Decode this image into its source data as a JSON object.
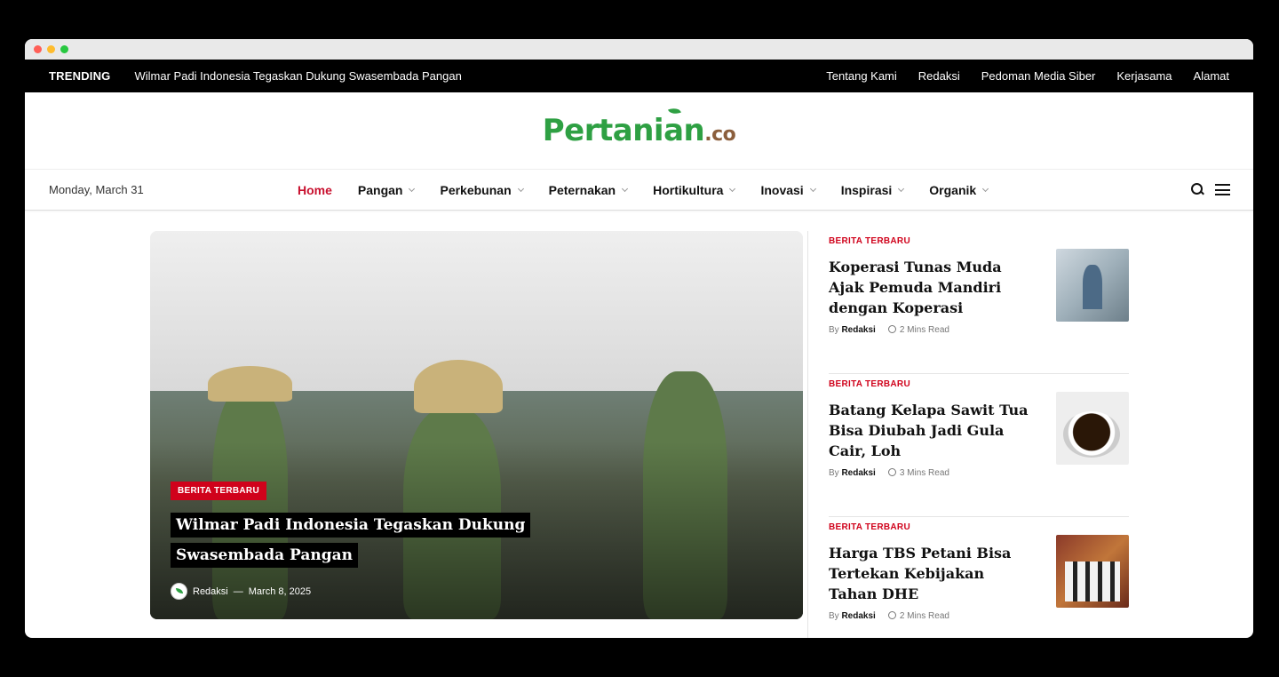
{
  "topbar": {
    "trending_label": "TRENDING",
    "trending_headline": "Wilmar Padi Indonesia Tegaskan Dukung Swasembada Pangan",
    "links": [
      "Tentang Kami",
      "Redaksi",
      "Pedoman Media Siber",
      "Kerjasama",
      "Alamat"
    ]
  },
  "logo": {
    "main": "Pertanian",
    "suffix": ".co"
  },
  "nav": {
    "date": "Monday, March 31",
    "items": [
      {
        "label": "Home"
      },
      {
        "label": "Pangan"
      },
      {
        "label": "Perkebunan"
      },
      {
        "label": "Peternakan"
      },
      {
        "label": "Hortikultura"
      },
      {
        "label": "Inovasi"
      },
      {
        "label": "Inspirasi"
      },
      {
        "label": "Organik"
      }
    ]
  },
  "hero": {
    "category": "BERITA TERBARU",
    "title": "Wilmar Padi Indonesia Tegaskan Dukung Swasembada Pangan",
    "author": "Redaksi",
    "separator": "—",
    "date": "March 8, 2025"
  },
  "sidebar": {
    "posts": [
      {
        "category": "BERITA TERBARU",
        "title": "Koperasi Tunas Muda Ajak Pemuda Mandiri dengan Koperasi",
        "by": "By",
        "author": "Redaksi",
        "read": "2 Mins Read"
      },
      {
        "category": "BERITA TERBARU",
        "title": "Batang Kelapa Sawit Tua Bisa Diubah Jadi Gula Cair, Loh",
        "by": "By",
        "author": "Redaksi",
        "read": "3 Mins Read"
      },
      {
        "category": "BERITA TERBARU",
        "title": "Harga TBS Petani Bisa Tertekan Kebijakan Tahan DHE",
        "by": "By",
        "author": "Redaksi",
        "read": "2 Mins Read"
      }
    ]
  },
  "colors": {
    "accent": "#d0021b",
    "brand_green": "#2ea043",
    "brand_brown": "#8b5e3c"
  }
}
